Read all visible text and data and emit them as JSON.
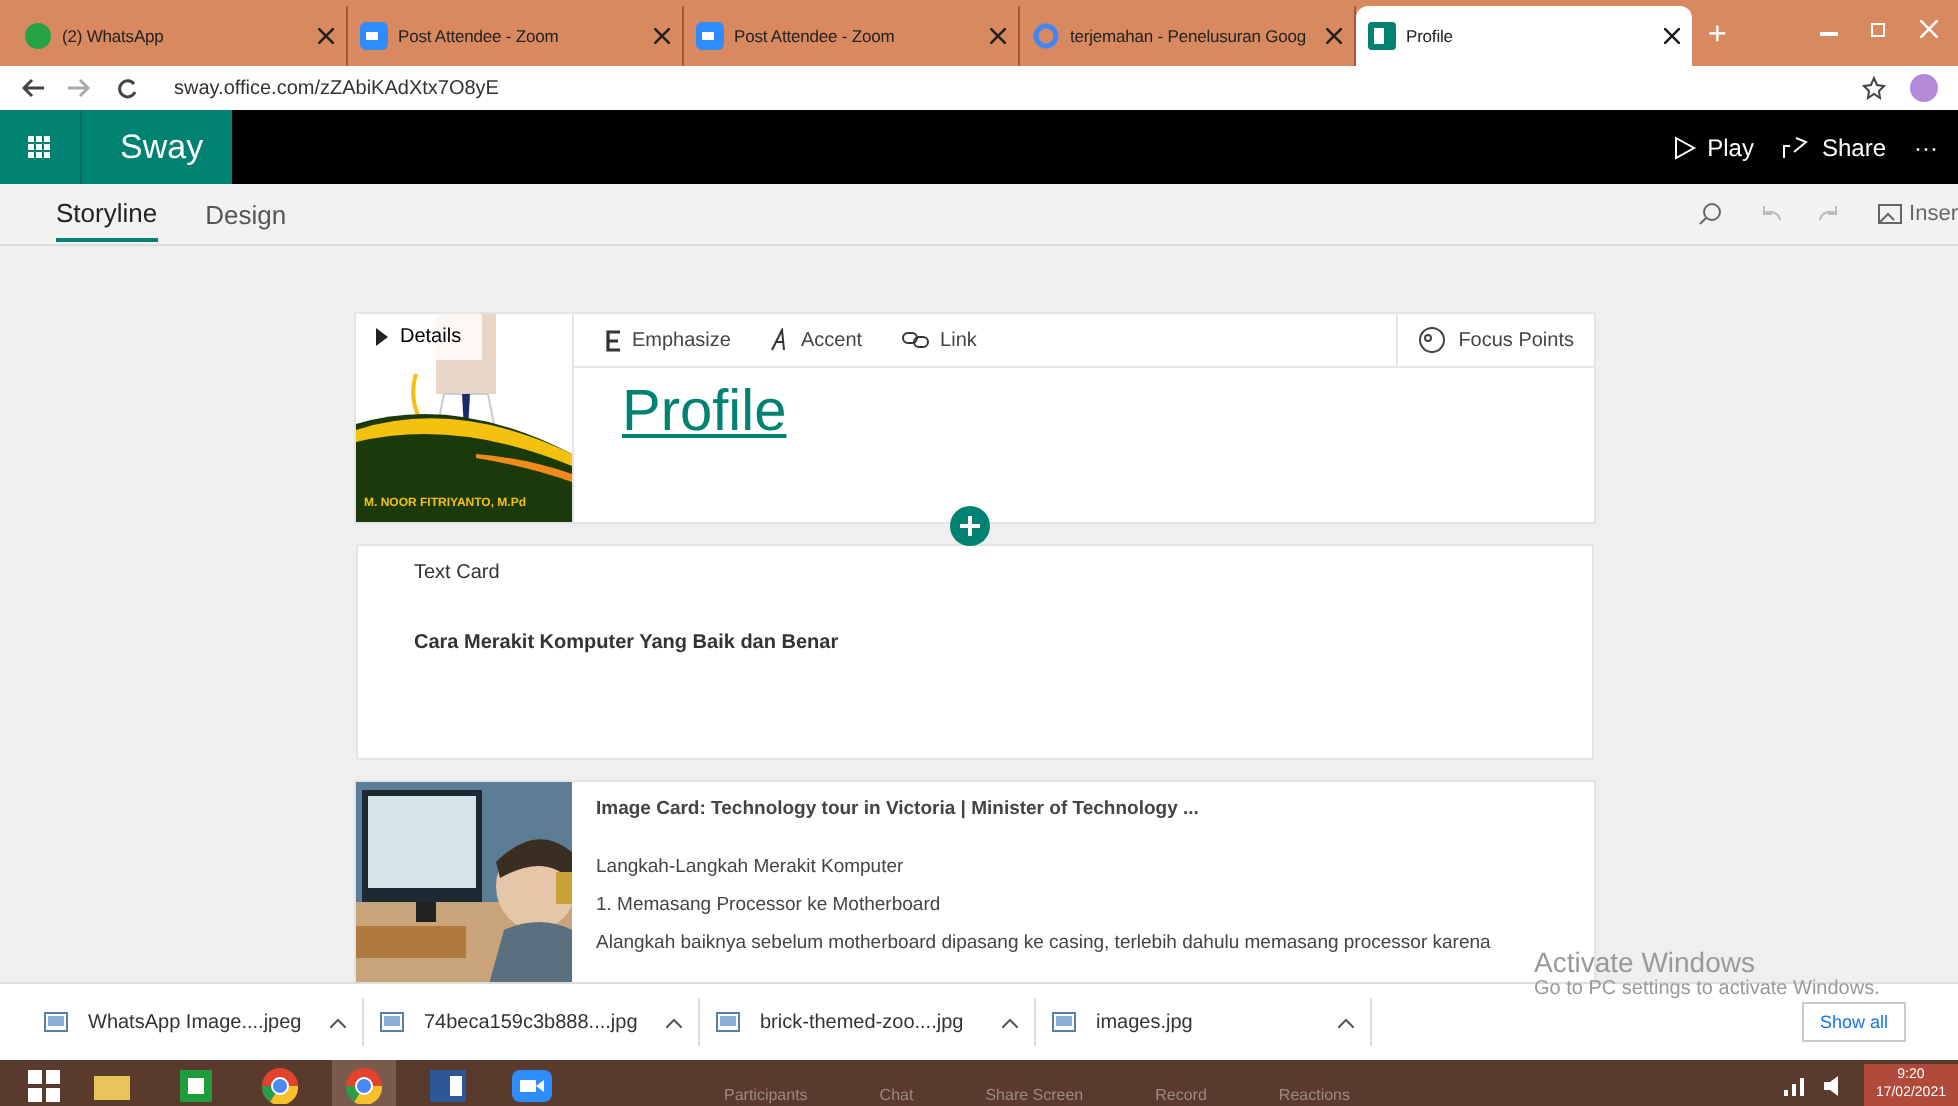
{
  "browser_tabs": [
    {
      "label": "(2) WhatsApp",
      "kind": "chat",
      "selected": false
    },
    {
      "label": "Post Attendee - Zoom",
      "kind": "video",
      "selected": false
    },
    {
      "label": "Post Attendee - Zoom",
      "kind": "video",
      "selected": false
    },
    {
      "label": "terjemahan - Penelusuran Goog",
      "kind": "search",
      "selected": false
    },
    {
      "label": "Profile",
      "kind": "document",
      "selected": true
    }
  ],
  "new_tab": "+",
  "address": "sway.office.com/zZAbiKAdXtx7O8yE",
  "app_bar": {
    "title": "Sway",
    "play": "Play",
    "share": "Share",
    "more": "···"
  },
  "view_tabs": [
    {
      "label": "Storyline",
      "selected": true
    },
    {
      "label": "Design",
      "selected": false
    }
  ],
  "insert": "Inser",
  "title_card": {
    "details": "Details",
    "tools": [
      "Emphasize",
      "Accent",
      "Link"
    ],
    "focus": "Focus Points",
    "image_caption": "M. NOOR FITRIYANTO, M.Pd",
    "title": "Profile"
  },
  "text_card": {
    "label": "Text Card",
    "text": "Cara Merakit Komputer Yang Baik dan Benar"
  },
  "image_card": {
    "label": "Image Card: Technology tour in Victoria | Minister of Technology ...",
    "lines": [
      "Langkah-Langkah Merakit Komputer",
      "1. Memasang Processor ke Motherboard",
      "Alangkah baiknya sebelum motherboard dipasang ke casing, terlebih dahulu memasang processor karena"
    ]
  },
  "activation": {
    "title": "Activate Windows",
    "text": "Go to PC settings to activate Windows."
  },
  "downloads": [
    "WhatsApp Image....jpeg",
    "74beca159c3b888....jpg",
    "brick-themed-zoo....jpg",
    "images.jpg"
  ],
  "show_all": "Show all",
  "meeting_controls": [
    "Participants",
    "Chat",
    "Share Screen",
    "Record",
    "Reactions"
  ],
  "clock": {
    "time": "9:20",
    "date": "17/02/2021"
  }
}
